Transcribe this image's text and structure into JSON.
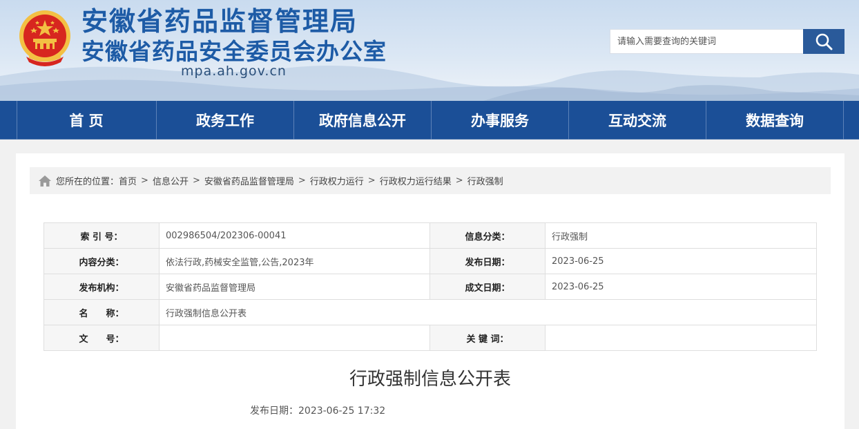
{
  "header": {
    "title_line1": "安徽省药品监督管理局",
    "title_line2": "安徽省药品安全委员会办公室",
    "domain": "mpa.ah.gov.cn",
    "emblem_icon": "national-emblem-icon",
    "search": {
      "placeholder": "请输入需要查询的关键词",
      "value": "",
      "button_icon": "search-icon"
    }
  },
  "nav": {
    "items": [
      {
        "label": "首 页"
      },
      {
        "label": "政务工作"
      },
      {
        "label": "政府信息公开"
      },
      {
        "label": "办事服务"
      },
      {
        "label": "互动交流"
      },
      {
        "label": "数据查询"
      }
    ]
  },
  "breadcrumb": {
    "icon": "home-icon",
    "prefix": "您所在的位置：",
    "items": [
      "首页",
      "信息公开",
      "安徽省药品监督管理局",
      "行政权力运行",
      "行政权力运行结果",
      "行政强制"
    ],
    "separator": ">"
  },
  "meta": {
    "index_label": "索 引 号：",
    "index_value": "002986504/202306-00041",
    "category_label": "信息分类：",
    "category_value": "行政强制",
    "content_label": "内容分类：",
    "content_value": "依法行政,药械安全监管,公告,2023年",
    "publish_date_label": "发布日期：",
    "publish_date_value": "2023-06-25",
    "org_label": "发布机构：",
    "org_value": "安徽省药品监督管理局",
    "created_date_label": "成文日期：",
    "created_date_value": "2023-06-25",
    "name_label": "名　　称：",
    "name_value": "行政强制信息公开表",
    "docno_label": "文　　号：",
    "docno_value": "",
    "keywords_label": "关 键 词：",
    "keywords_value": ""
  },
  "document": {
    "title": "行政强制信息公开表",
    "pub_date": "发布日期：2023-06-25 17:32"
  },
  "colors": {
    "brand_blue": "#1b4f97",
    "title_blue": "#1d5ba6",
    "emblem_red": "#d7261f",
    "emblem_gold": "#f3c043"
  }
}
